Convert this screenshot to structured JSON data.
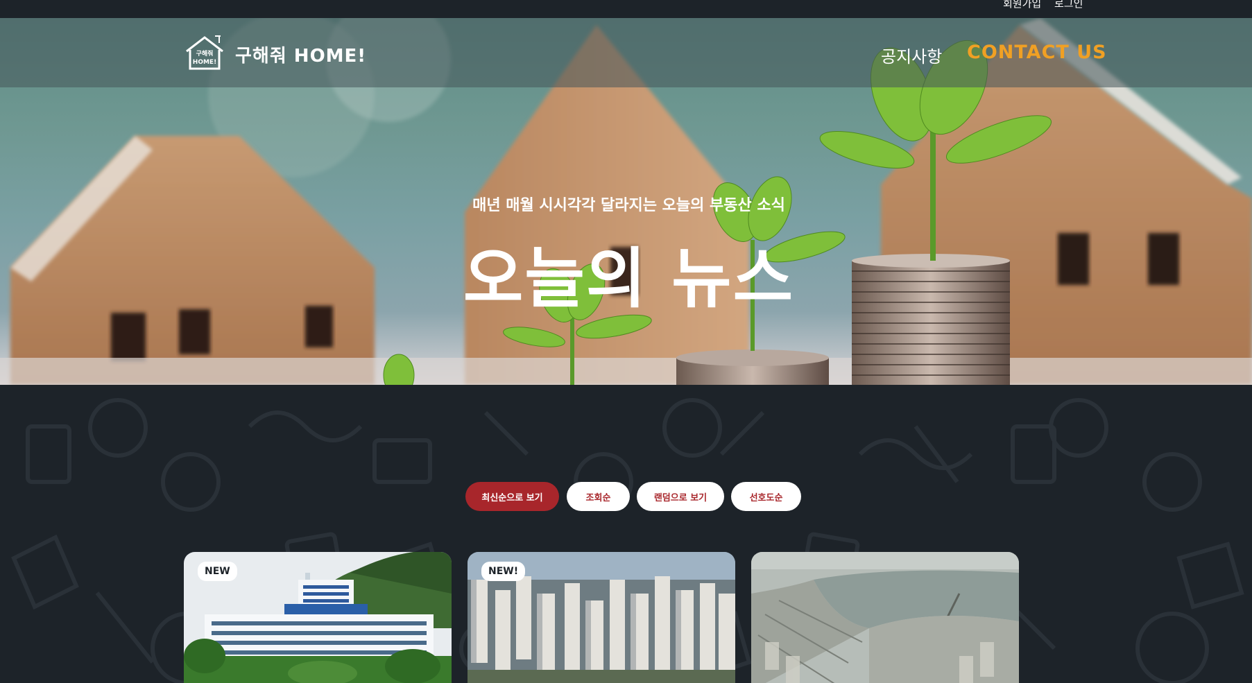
{
  "topbar": {
    "signup": "회원가입",
    "login": "로그인"
  },
  "header": {
    "brand": "구해줘 HOME!",
    "logo_text_top": "구해줘",
    "logo_text_bottom": "HOME!",
    "nav_notice": "공지사항",
    "nav_contact": "CONTACT US"
  },
  "hero": {
    "subtitle": "매년 매월 시시각각 달라지는 오늘의 부동산 소식",
    "title": "오늘의 뉴스"
  },
  "filters": [
    {
      "label": "최신순으로 보기",
      "active": true
    },
    {
      "label": "조회순",
      "active": false
    },
    {
      "label": "랜덤으로 보기",
      "active": false
    },
    {
      "label": "선호도순",
      "active": false
    }
  ],
  "cards": [
    {
      "badge": "NEW",
      "image": "government-building-photo"
    },
    {
      "badge": "NEW!",
      "image": "apartment-complex-photo"
    },
    {
      "badge": "",
      "image": "city-river-aerial-photo"
    }
  ],
  "colors": {
    "accent": "#f0a024",
    "filter_active": "#a8262b",
    "background": "#1d2329"
  }
}
